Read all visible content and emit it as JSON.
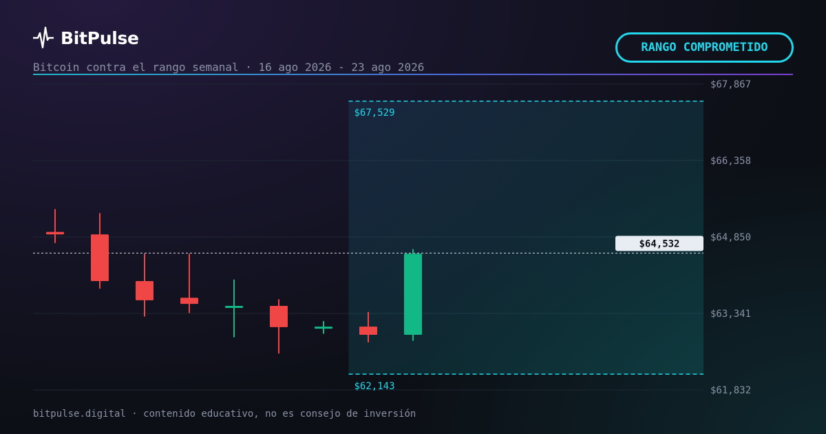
{
  "brand": {
    "name": "BitPulse",
    "icon": "pulse-icon"
  },
  "subtitle": "Bitcoin contra el rango semanal · 16 ago 2026 - 23 ago 2026",
  "badge": {
    "label": "RANGO COMPROMETIDO"
  },
  "footer": "bitpulse.digital · contenido educativo, no es consejo de inversión",
  "colors": {
    "up": "#12b886",
    "down": "#f04646",
    "range": "#22d8ec",
    "grid": "#1e2633",
    "axis_text": "#8a93a6",
    "price_label_bg": "#e8ecf3"
  },
  "chart_data": {
    "type": "candlestick",
    "ylim": [
      61832,
      67867
    ],
    "y_ticks": [
      "$67,867",
      "$66,358",
      "$64,850",
      "$63,341",
      "$61,832"
    ],
    "y_tick_values": [
      67867,
      66358,
      64850,
      63341,
      61832
    ],
    "candles": [
      {
        "open": 64950,
        "close": 64900,
        "high": 65400,
        "low": 64730
      },
      {
        "open": 64900,
        "close": 63980,
        "high": 65320,
        "low": 63830
      },
      {
        "open": 63980,
        "close": 63600,
        "high": 64520,
        "low": 63280
      },
      {
        "open": 63650,
        "close": 63530,
        "high": 64520,
        "low": 63350
      },
      {
        "open": 63480,
        "close": 63490,
        "high": 64010,
        "low": 62870
      },
      {
        "open": 63490,
        "close": 63070,
        "high": 63620,
        "low": 62550
      },
      {
        "open": 63070,
        "close": 63080,
        "high": 63190,
        "low": 62940
      },
      {
        "open": 63080,
        "close": 62920,
        "high": 63370,
        "low": 62770
      },
      {
        "open": 62920,
        "close": 64520,
        "high": 64610,
        "low": 62800
      }
    ],
    "range": {
      "high": 67529,
      "low": 62143,
      "high_label": "$67,529",
      "low_label": "$62,143",
      "start_index": 7
    },
    "current_price": {
      "value": 64532,
      "label": "$64,532"
    }
  }
}
